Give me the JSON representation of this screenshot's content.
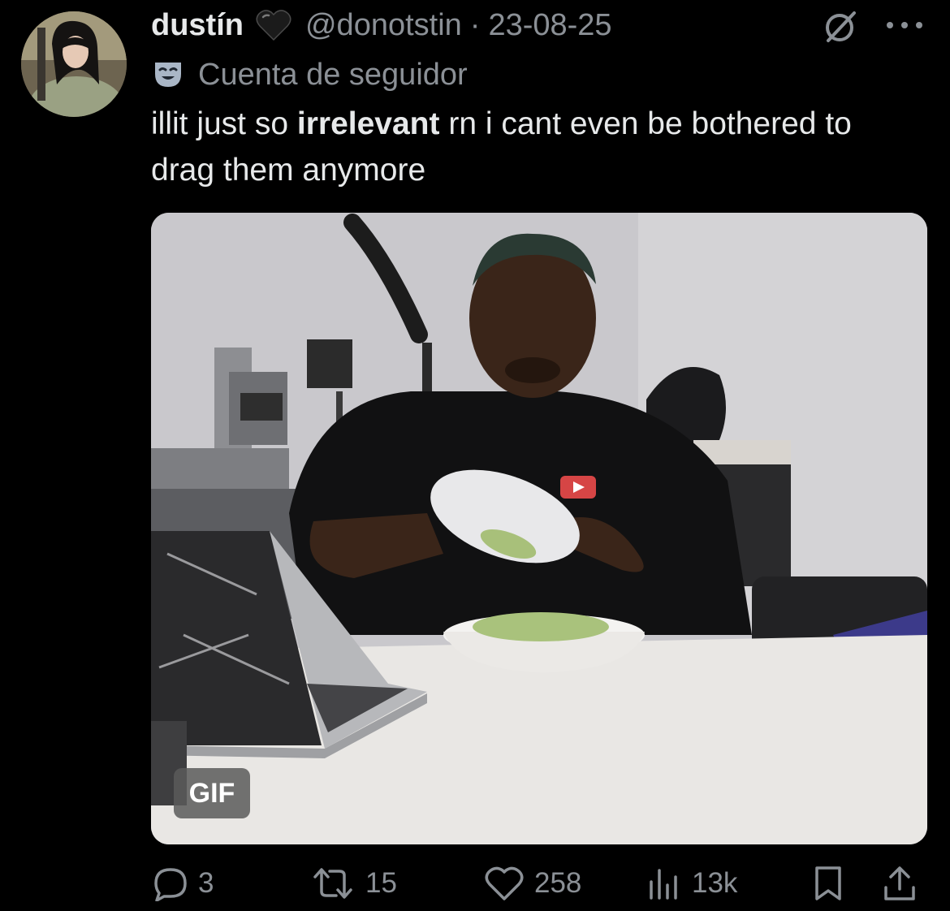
{
  "author": {
    "display_name": "dustín",
    "handle": "@donotstin",
    "separator": "·",
    "timestamp": "23-08-25",
    "name_emoji": "black-heart"
  },
  "account_type": {
    "icon": "theater-masks-icon",
    "label": "Cuenta de seguidor"
  },
  "post": {
    "text_before": "illit just so ",
    "text_bold": "irrelevant",
    "text_after": " rn i cant even be bothered to drag them anymore"
  },
  "media": {
    "badge": "GIF"
  },
  "actions": {
    "replies": "3",
    "reposts": "15",
    "likes": "258",
    "views": "13k"
  },
  "colors": {
    "background": "#000000",
    "primary_text": "#e7e9ea",
    "secondary_text": "#8b9096",
    "theater_icon": "#a9b6c6"
  }
}
